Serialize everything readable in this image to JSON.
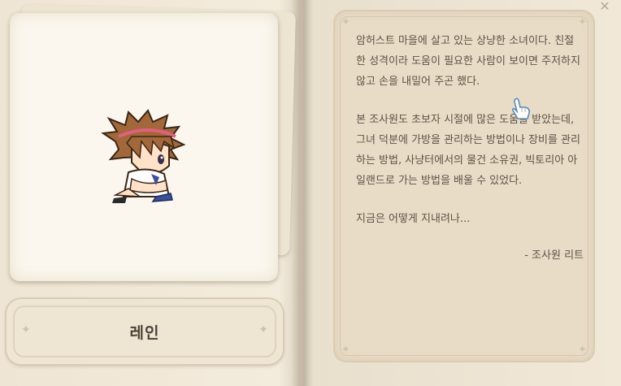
{
  "character": {
    "name": "레인"
  },
  "story": {
    "paragraphs": [
      "암허스트 마을에 살고 있는 상냥한 소녀이다. 친절한 성격이라 도움이 필요한 사람이 보이면 주저하지 않고 손을 내밀어 주곤 했다.",
      "본 조사원도 초보자 시절에 많은 도움을 받았는데, 그녀 덕분에 가방을 관리하는 방법이나 장비를 관리하는 방법, 사냥터에서의 물건 소유권, 빅토리아 아일랜드로 가는 방법을 배울 수 있었다.",
      "지금은 어떻게 지내려나..."
    ],
    "signature": "- 조사원 리트"
  },
  "icons": {
    "close": "close-icon",
    "cursor": "hand-cursor-icon",
    "sparkle": "sparkle-icon"
  },
  "colors": {
    "page": "#efe6d6",
    "panel": "#e9dcc7",
    "text": "#5c5246",
    "accent_pink": "#e0607e"
  }
}
